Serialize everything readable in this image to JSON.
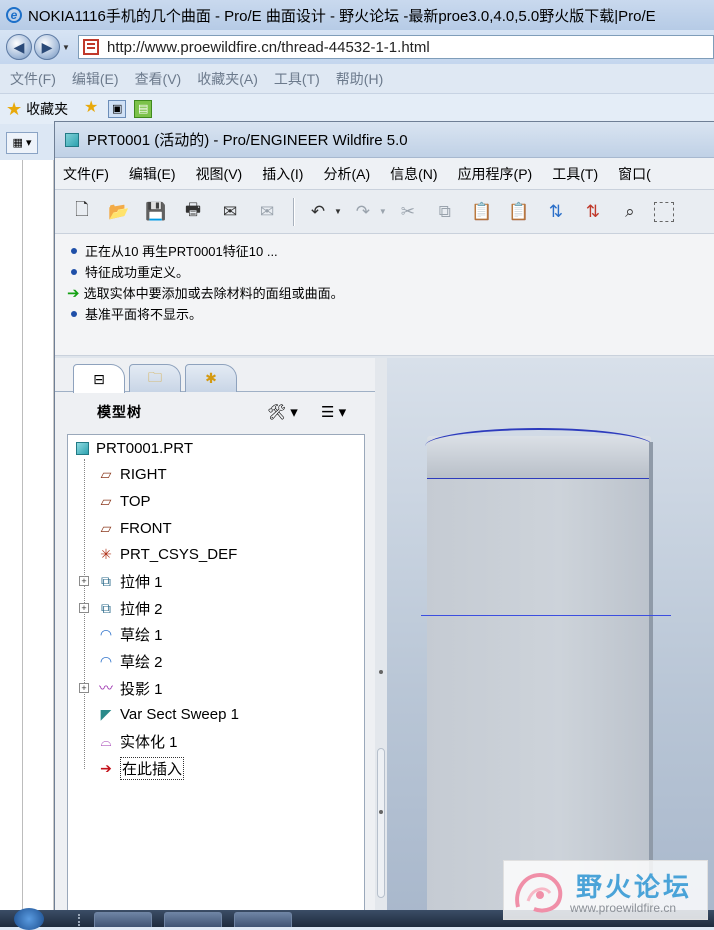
{
  "browser": {
    "title": "NOKIA1116手机的几个曲面 - Pro/E 曲面设计 - 野火论坛 -最新proe3.0,4.0,5.0野火版下载|Pro/E",
    "url": "http://www.proewildfire.cn/thread-44532-1-1.html",
    "menu": [
      "文件(F)",
      "编辑(E)",
      "查看(V)",
      "收藏夹(A)",
      "工具(T)",
      "帮助(H)"
    ],
    "favorites_label": "收藏夹"
  },
  "proe": {
    "title": "PRT0001 (活动的) - Pro/ENGINEER Wildfire 5.0",
    "menu": [
      "文件(F)",
      "编辑(E)",
      "视图(V)",
      "插入(I)",
      "分析(A)",
      "信息(N)",
      "应用程序(P)",
      "工具(T)",
      "窗口("
    ],
    "messages": [
      {
        "type": "info",
        "text": "正在从10 再生PRT0001特征10 ..."
      },
      {
        "type": "info",
        "text": "特征成功重定义。"
      },
      {
        "type": "prompt",
        "text": "选取实体中要添加或去除材料的面组或曲面。"
      },
      {
        "type": "info",
        "text": "基准平面将不显示。"
      }
    ],
    "model_tree": {
      "title": "模型树",
      "nodes": [
        {
          "label": "PRT0001.PRT",
          "icon": "part-icon"
        },
        {
          "label": "RIGHT",
          "icon": "datum-plane-icon"
        },
        {
          "label": "TOP",
          "icon": "datum-plane-icon"
        },
        {
          "label": "FRONT",
          "icon": "datum-plane-icon"
        },
        {
          "label": "PRT_CSYS_DEF",
          "icon": "csys-icon"
        },
        {
          "label": "拉伸 1",
          "icon": "extrude-icon"
        },
        {
          "label": "拉伸 2",
          "icon": "extrude-icon"
        },
        {
          "label": "草绘 1",
          "icon": "sketch-icon"
        },
        {
          "label": "草绘 2",
          "icon": "sketch-icon"
        },
        {
          "label": "投影 1",
          "icon": "projection-icon"
        },
        {
          "label": "Var Sect Sweep 1",
          "icon": "sweep-icon"
        },
        {
          "label": "实体化 1",
          "icon": "solidify-icon"
        },
        {
          "label": "在此插入",
          "icon": "insert-here-icon"
        }
      ]
    }
  },
  "watermark": {
    "name": "野火论坛",
    "site": "www.proewildfire.cn"
  },
  "colors": {
    "accent": "#1f4fa8",
    "datum_edge": "#2d3bbd",
    "insert_arrow": "#c4121a"
  }
}
